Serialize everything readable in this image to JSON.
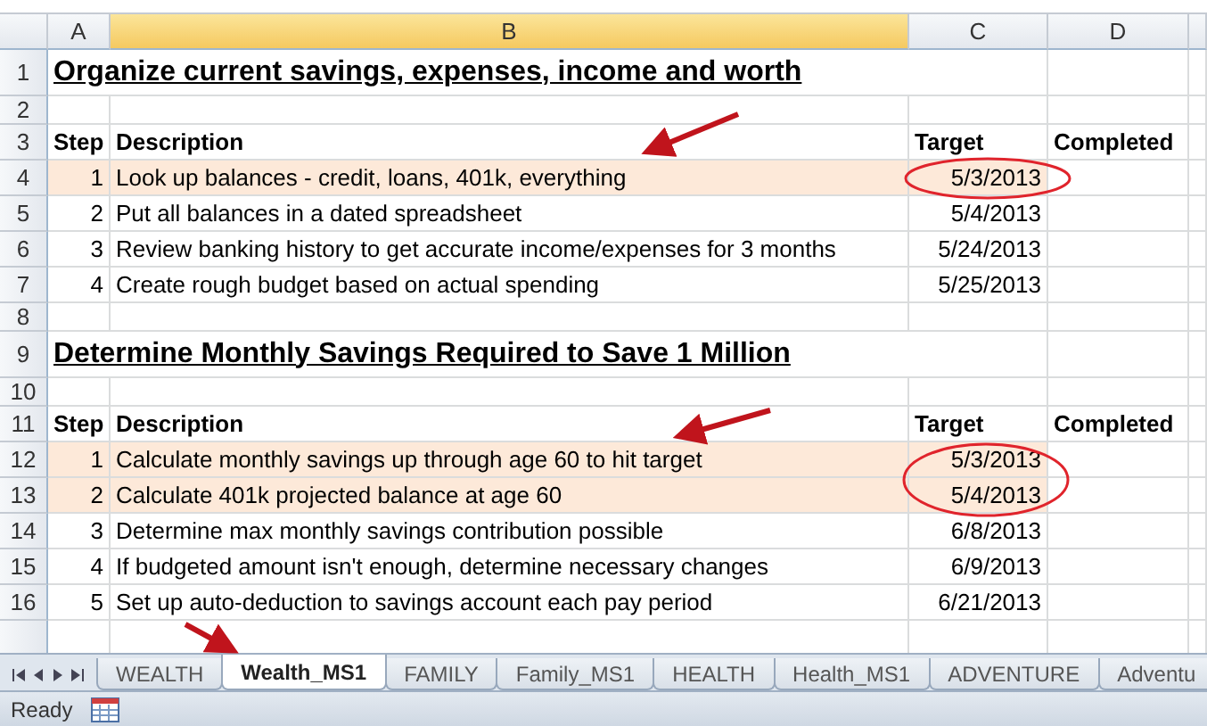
{
  "columns": [
    {
      "label": "A",
      "selected": false
    },
    {
      "label": "B",
      "selected": true
    },
    {
      "label": "C",
      "selected": false
    },
    {
      "label": "D",
      "selected": false
    }
  ],
  "rows": [
    {
      "number": "1",
      "kind": "title",
      "text": "Organize current savings, expenses, income and worth"
    },
    {
      "number": "2",
      "kind": "blank"
    },
    {
      "number": "3",
      "kind": "header",
      "cells": [
        "Step",
        "Description",
        "Target",
        "Completed"
      ]
    },
    {
      "number": "4",
      "kind": "step",
      "step": "1",
      "description": "Look up balances - credit, loans, 401k, everything",
      "target": "5/3/2013",
      "highlighted": true
    },
    {
      "number": "5",
      "kind": "step",
      "step": "2",
      "description": "Put all balances in a dated spreadsheet",
      "target": "5/4/2013",
      "highlighted": false
    },
    {
      "number": "6",
      "kind": "step",
      "step": "3",
      "description": "Review banking history to get accurate income/expenses for 3 months",
      "target": "5/24/2013",
      "highlighted": false
    },
    {
      "number": "7",
      "kind": "step",
      "step": "4",
      "description": "Create rough budget based on actual spending",
      "target": "5/25/2013",
      "highlighted": false
    },
    {
      "number": "8",
      "kind": "blank"
    },
    {
      "number": "9",
      "kind": "title",
      "text": "Determine Monthly Savings Required to Save 1 Million"
    },
    {
      "number": "10",
      "kind": "blank"
    },
    {
      "number": "11",
      "kind": "header",
      "cells": [
        "Step",
        "Description",
        "Target",
        "Completed"
      ]
    },
    {
      "number": "12",
      "kind": "step",
      "step": "1",
      "description": "Calculate monthly savings up through age 60 to hit target",
      "target": "5/3/2013",
      "highlighted": true
    },
    {
      "number": "13",
      "kind": "step",
      "step": "2",
      "description": "Calculate 401k projected balance at age 60",
      "target": "5/4/2013",
      "highlighted": true
    },
    {
      "number": "14",
      "kind": "step",
      "step": "3",
      "description": "Determine max monthly savings contribution possible",
      "target": "6/8/2013",
      "highlighted": false
    },
    {
      "number": "15",
      "kind": "step",
      "step": "4",
      "description": "If budgeted amount isn't enough, determine necessary changes",
      "target": "6/9/2013",
      "highlighted": false
    },
    {
      "number": "16",
      "kind": "step",
      "step": "5",
      "description": "Set up auto-deduction to savings account each pay period",
      "target": "6/21/2013",
      "highlighted": false
    }
  ],
  "sheet_tabs": [
    {
      "label": "WEALTH",
      "selected": false
    },
    {
      "label": "Wealth_MS1",
      "selected": true
    },
    {
      "label": "FAMILY",
      "selected": false
    },
    {
      "label": "Family_MS1",
      "selected": false
    },
    {
      "label": "HEALTH",
      "selected": false
    },
    {
      "label": "Health_MS1",
      "selected": false
    },
    {
      "label": "ADVENTURE",
      "selected": false
    },
    {
      "label": "Adventu",
      "selected": false
    }
  ],
  "status_bar": {
    "text": "Ready"
  }
}
